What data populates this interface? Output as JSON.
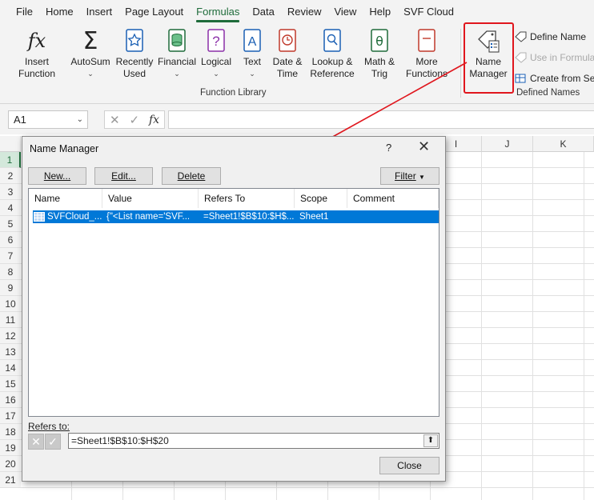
{
  "menu": [
    "File",
    "Home",
    "Insert",
    "Page Layout",
    "Formulas",
    "Data",
    "Review",
    "View",
    "Help",
    "SVF Cloud"
  ],
  "active_menu": "Formulas",
  "ribbon": {
    "insert_function": "Insert\nFunction",
    "autosum": "AutoSum",
    "recently_used": "Recently\nUsed",
    "financial": "Financial",
    "logical": "Logical",
    "text": "Text",
    "date_time": "Date &\nTime",
    "lookup_reference": "Lookup &\nReference",
    "math_trig": "Math &\nTrig",
    "more_functions": "More\nFunctions",
    "function_library_label": "Function Library",
    "name_manager": "Name\nManager",
    "define_name": "Define Name",
    "use_in_formula": "Use in Formula",
    "create_from_selection": "Create from Se",
    "defined_names_label": "Defined Names"
  },
  "formula_bar": {
    "name_box": "A1",
    "fx": "fx",
    "value": ""
  },
  "sheet": {
    "columns": [
      "I",
      "J",
      "K"
    ],
    "rows": [
      "1",
      "2",
      "3",
      "4",
      "5",
      "6",
      "7",
      "8",
      "9",
      "10",
      "11",
      "12",
      "13",
      "14",
      "15",
      "16",
      "17",
      "18",
      "19",
      "20",
      "21"
    ]
  },
  "dialog": {
    "title": "Name Manager",
    "help": "?",
    "new_btn": "New...",
    "edit_btn": "Edit...",
    "delete_btn": "Delete",
    "filter_btn": "Filter",
    "columns": [
      "Name",
      "Value",
      "Refers To",
      "Scope",
      "Comment"
    ],
    "rows": [
      {
        "name": "SVFCloud_...",
        "value": "{\"<List name='SVF...",
        "refers_to": "=Sheet1!$B$10:$H$...",
        "scope": "Sheet1",
        "comment": ""
      }
    ],
    "refers_to_label": "Refers to:",
    "refers_to_value": "=Sheet1!$B$10:$H$20",
    "close_btn": "Close"
  },
  "colors": {
    "accent": "#1e6b3a",
    "highlight": "#e0161d",
    "selection": "#0078d7"
  }
}
